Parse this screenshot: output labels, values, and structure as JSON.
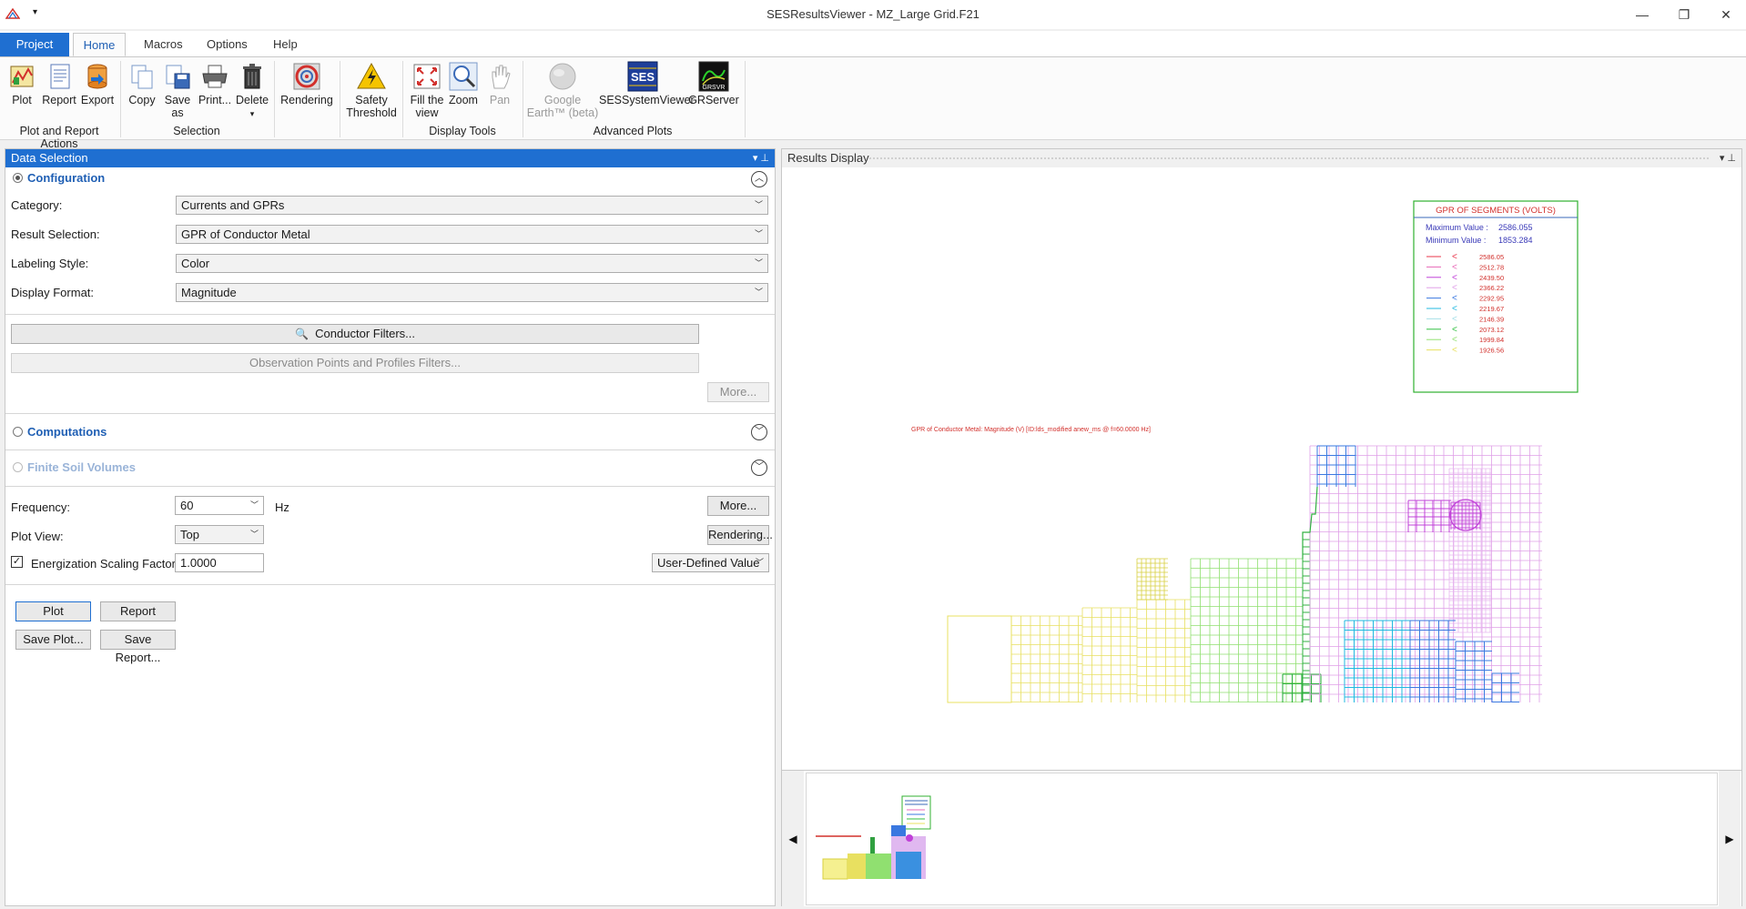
{
  "window": {
    "title": "SESResultsViewer - MZ_Large Grid.F21",
    "minimize_glyph": "—",
    "restore_glyph": "❐",
    "close_glyph": "✕",
    "qat_glyph": "▾"
  },
  "tabs": {
    "project": "Project",
    "home": "Home",
    "macros": "Macros",
    "options": "Options",
    "help": "Help"
  },
  "ribbon": {
    "plot": "Plot",
    "report": "Report",
    "export": "Export",
    "copy": "Copy",
    "save_as_1": "Save",
    "save_as_2": "as",
    "print": "Print...",
    "delete": "Delete",
    "delete_arrow": "▾",
    "rendering": "Rendering",
    "safety_1": "Safety",
    "safety_2": "Threshold",
    "fill_1": "Fill the",
    "fill_2": "view",
    "zoom": "Zoom",
    "pan": "Pan",
    "google_1": "Google",
    "google_2": "Earth™ (beta)",
    "sessystemviewer": "SESSystemViewer",
    "grserver": "GRServer",
    "ses_logo_text": "SES",
    "grserver_logo_text": "GRSVR",
    "groups": {
      "plot_report": "Plot and Report Actions",
      "selection": "Selection",
      "display_tools": "Display Tools",
      "advanced_plots": "Advanced Plots"
    }
  },
  "data_selection": {
    "header": "Data Selection",
    "header_icons": "▾ ⊥",
    "configuration": "Configuration",
    "category_label": "Category:",
    "category_value": "Currents and GPRs",
    "result_label": "Result Selection:",
    "result_value": "GPR of Conductor Metal",
    "labeling_label": "Labeling Style:",
    "labeling_value": "Color",
    "display_label": "Display Format:",
    "display_value": "Magnitude",
    "conductor_filters": "Conductor Filters...",
    "observation_filters": "Observation Points and Profiles Filters...",
    "more": "More...",
    "computations": "Computations",
    "finite_soil": "Finite Soil Volumes",
    "frequency_label": "Frequency:",
    "frequency_value": "60",
    "frequency_unit": "Hz",
    "more2": "More...",
    "plot_view_label": "Plot View:",
    "plot_view_value": "Top",
    "rendering": "Rendering...",
    "energization_label": "Energization Scaling Factor:",
    "energization_value": "1.0000",
    "energization_checked": true,
    "check_glyph": "✓",
    "user_defined": "User-Defined Value",
    "plot_btn": "Plot",
    "report_btn": "Report",
    "save_plot_btn": "Save Plot...",
    "save_report_btn": "Save Report..."
  },
  "results_display": {
    "header": "Results Display",
    "header_icons": "▾ ⊥",
    "legend_title": "GPR OF SEGMENTS (VOLTS)",
    "max_label": "Maximum Value :",
    "max_value": "2586.055",
    "min_label": "Minimum Value :",
    "min_value": "1853.284",
    "legend_symbol": "<",
    "legend_entries": [
      "2586.05",
      "2512.78",
      "2439.50",
      "2366.22",
      "2292.95",
      "2219.67",
      "2146.39",
      "2073.12",
      "1999.84",
      "1926.56"
    ],
    "legend_colors": [
      "#e8344a",
      "#e86ab8",
      "#c040d8",
      "#e0a0e8",
      "#3a78e0",
      "#20b8e0",
      "#a8e0e8",
      "#30c040",
      "#90e070",
      "#e8e060"
    ],
    "plot_caption": "GPR of Conductor Metal: Magnitude (V) [ID:lds_modified anew_ms  @ f=60.0000 Hz]",
    "nav_left": "◀",
    "nav_right": "▶"
  }
}
